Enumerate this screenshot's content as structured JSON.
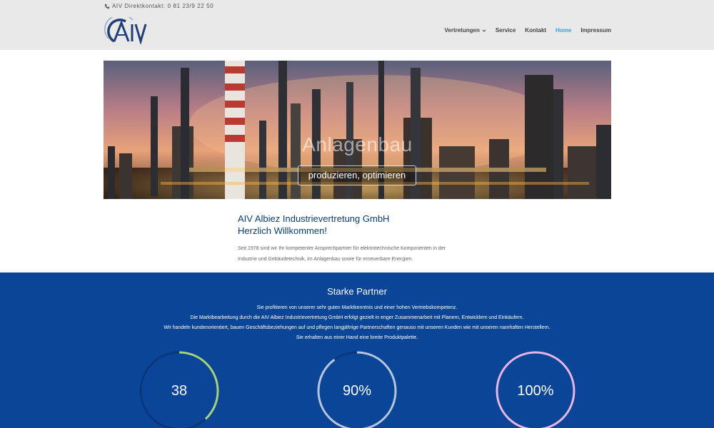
{
  "header": {
    "contact_label": "AIV Direktkontakt: 0 81 23/9 22 50",
    "logo_text": "AIV",
    "nav": [
      {
        "label": "Vertretungen",
        "dropdown": true,
        "active": false
      },
      {
        "label": "Service",
        "dropdown": false,
        "active": false
      },
      {
        "label": "Kontakt",
        "dropdown": false,
        "active": false
      },
      {
        "label": "Home",
        "dropdown": false,
        "active": true
      },
      {
        "label": "Impressum",
        "dropdown": false,
        "active": false
      }
    ],
    "active_color": "#2ea3f2"
  },
  "hero": {
    "title": "Anlagenbau",
    "button_label": "produzieren, optimieren"
  },
  "intro": {
    "heading_line1": "AIV Albiez Industrievertretung GmbH",
    "heading_line2": "Herzlich Willkommen!",
    "text_line1": "Seit 1978 sind wir Ihr kompetenter Ansprechpartner für elektrotechnische Komponenten in der",
    "text_line2": "Industrie und Gebäudetechnik, im Anlagenbau sowie für erneuerbare Energien."
  },
  "partners": {
    "title": "Starke Partner",
    "lines": [
      "Sie profitieren von unserer sehr guten Marktkenntnis und einer hohen Vertriebskompetenz.",
      "Die Marktbearbeitung durch die AIV Albiez Industrievertretung GmbH erfolgt gezielt in enger Zusammenarbeit mit Planern, Entwicklern und Einkäufern.",
      "Wir handeln kundenorientiert, bauen Geschäftsbeziehungen auf und pflegen langjährige Partnerschaften genauso mit unseren Kunden wie mit unseren namhaften Herstellern.",
      "Sie erhalten aus einer Hand eine breite Produktpalette."
    ],
    "background_color": "#0a4597"
  },
  "counters": [
    {
      "value": "38",
      "fraction": 0.38,
      "color": "#a6d27a"
    },
    {
      "value": "90%",
      "fraction": 0.9,
      "color": "#b6c6dd"
    },
    {
      "value": "100%",
      "fraction": 1.0,
      "color": "#e8b6e8"
    }
  ]
}
